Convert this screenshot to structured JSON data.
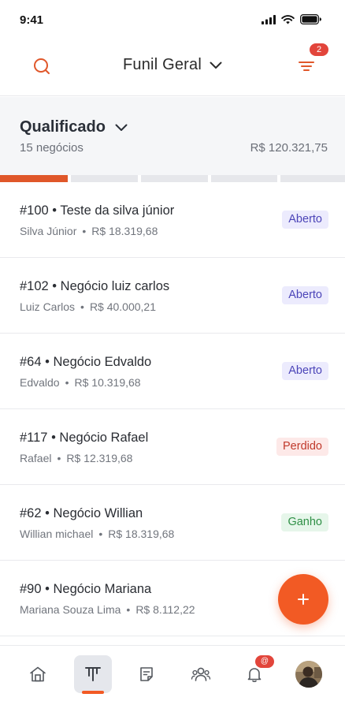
{
  "status_bar": {
    "time": "9:41"
  },
  "header": {
    "title": "Funil Geral",
    "filter_badge": "2"
  },
  "stage": {
    "name": "Qualificado",
    "count": "15 negócios",
    "total": "R$ 120.321,75"
  },
  "colors": {
    "accent": "#f25a24",
    "segment_inactive": "#e6e7eb",
    "badge_red": "#e2453b"
  },
  "deals": [
    {
      "title": "#100 • Teste da silva júnior",
      "contact": "Silva Júnior",
      "value": "R$ 18.319,68",
      "status": "Aberto"
    },
    {
      "title": "#102 • Negócio luiz carlos",
      "contact": "Luiz Carlos",
      "value": "R$ 40.000,21",
      "status": "Aberto"
    },
    {
      "title": "#64 • Negócio Edvaldo",
      "contact": "Edvaldo",
      "value": "R$ 10.319,68",
      "status": "Aberto"
    },
    {
      "title": "#117 • Negócio Rafael",
      "contact": "Rafael",
      "value": "R$ 12.319,68",
      "status": "Perdido"
    },
    {
      "title": "#62 • Negócio Willian",
      "contact": "Willian michael",
      "value": "R$ 18.319,68",
      "status": "Ganho"
    },
    {
      "title": "#90 • Negócio Mariana",
      "contact": "Mariana Souza Lima",
      "value": "R$ 8.112,22",
      "status": ""
    }
  ],
  "dot": "•",
  "fab": {
    "label": "+"
  },
  "nav": {
    "notifications_badge": "@"
  },
  "icons": [
    "search-icon",
    "chevron-down-icon",
    "filter-icon",
    "home-icon",
    "pipeline-icon",
    "document-icon",
    "contacts-icon",
    "bell-icon",
    "avatar"
  ]
}
